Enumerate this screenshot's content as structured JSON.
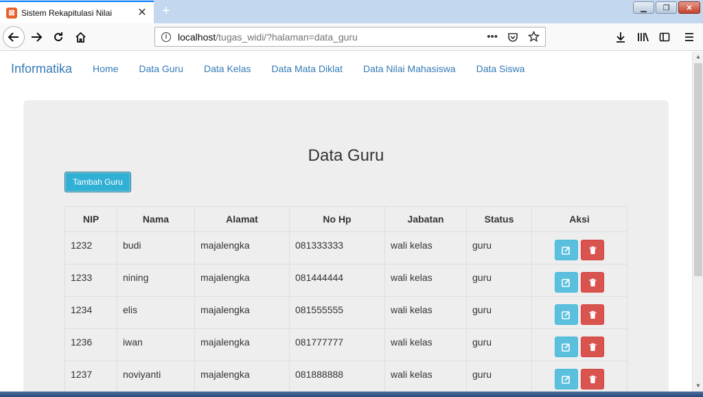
{
  "browser": {
    "tab_title": "Sistem Rekapitulasi Nilai",
    "tab_close": "✕",
    "new_tab": "+",
    "url_host": "localhost",
    "url_path": "/tugas_widi/?halaman=data_guru",
    "page_actions_menu": "•••"
  },
  "site": {
    "brand": "Informatika",
    "nav": [
      "Home",
      "Data Guru",
      "Data Kelas",
      "Data Mata Diklat",
      "Data Nilai Mahasiswa",
      "Data Siswa"
    ]
  },
  "main": {
    "title": "Data Guru",
    "add_button": "Tambah Guru",
    "table": {
      "headers": [
        "NIP",
        "Nama",
        "Alamat",
        "No Hp",
        "Jabatan",
        "Status",
        "Aksi"
      ],
      "rows": [
        {
          "nip": "1232",
          "nama": "budi",
          "alamat": "majalengka",
          "hp": "081333333",
          "jabatan": "wali kelas",
          "status": "guru"
        },
        {
          "nip": "1233",
          "nama": "nining",
          "alamat": "majalengka",
          "hp": "081444444",
          "jabatan": "wali kelas",
          "status": "guru"
        },
        {
          "nip": "1234",
          "nama": "elis",
          "alamat": "majalengka",
          "hp": "081555555",
          "jabatan": "wali kelas",
          "status": "guru"
        },
        {
          "nip": "1236",
          "nama": "iwan",
          "alamat": "majalengka",
          "hp": "081777777",
          "jabatan": "wali kelas",
          "status": "guru"
        },
        {
          "nip": "1237",
          "nama": "noviyanti",
          "alamat": "majalengka",
          "hp": "081888888",
          "jabatan": "wali kelas",
          "status": "guru"
        }
      ]
    }
  },
  "colors": {
    "link": "#337ab7",
    "info_button": "#5bc0de",
    "danger_button": "#d9534f",
    "jumbotron": "#eeeeee"
  },
  "icons": {
    "edit": "edit-icon",
    "delete": "trash-icon"
  }
}
